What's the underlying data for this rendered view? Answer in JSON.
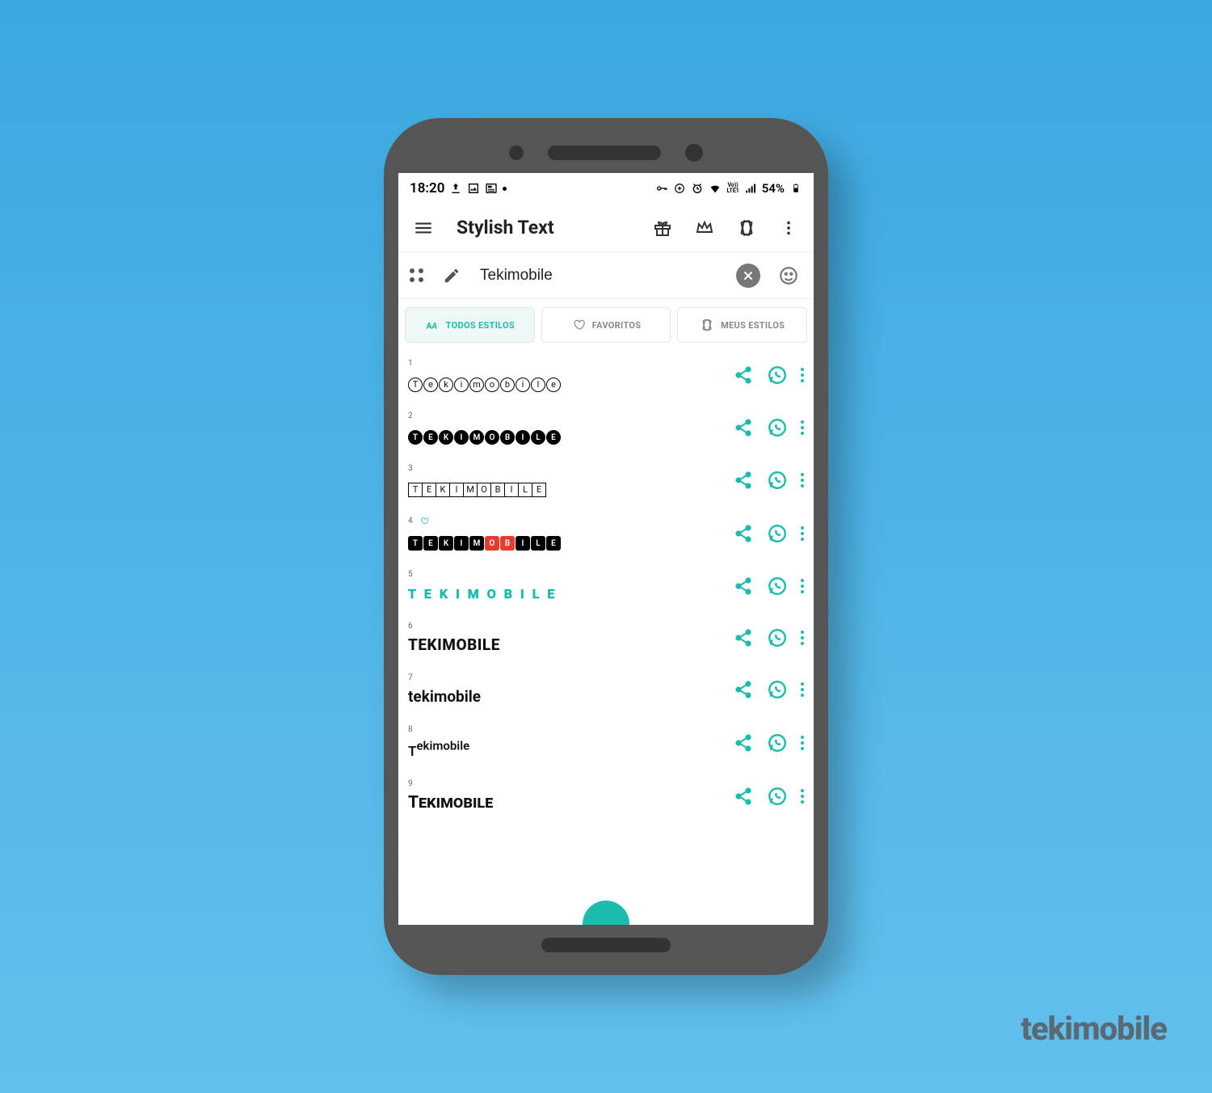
{
  "status": {
    "time": "18:20",
    "battery": "54%"
  },
  "header": {
    "title": "Stylish Text"
  },
  "input": {
    "value": "Tekimobile"
  },
  "tabs": {
    "all": "TODOS ESTILOS",
    "favorites": "FAVORITOS",
    "mine": "MEUS ESTILOS"
  },
  "styles": [
    {
      "idx": "1",
      "text": "Tekimobile",
      "render": "circle",
      "fav": false
    },
    {
      "idx": "2",
      "text": "TEKIMOBILE",
      "render": "filled-circle",
      "fav": false
    },
    {
      "idx": "3",
      "text": "TEKIMOBILE",
      "render": "boxed",
      "fav": false
    },
    {
      "idx": "4",
      "text": "TEKIMOBILE",
      "render": "filled-box-red",
      "fav": true
    },
    {
      "idx": "5",
      "text": "TEKIMOBILE",
      "render": "spaced-outline",
      "fav": false
    },
    {
      "idx": "6",
      "text": "TEKIMOBILE",
      "render": "bold-upper",
      "fav": false
    },
    {
      "idx": "7",
      "text": "tekimobile",
      "render": "plain-bold",
      "fav": false
    },
    {
      "idx": "8",
      "text": "Tekimobile",
      "render": "sup-start",
      "fav": false
    },
    {
      "idx": "9",
      "text": "Tekimobile",
      "render": "smallcaps",
      "fav": false
    }
  ],
  "watermark": "tekimobile",
  "colors": {
    "accent": "#1bbcae"
  }
}
